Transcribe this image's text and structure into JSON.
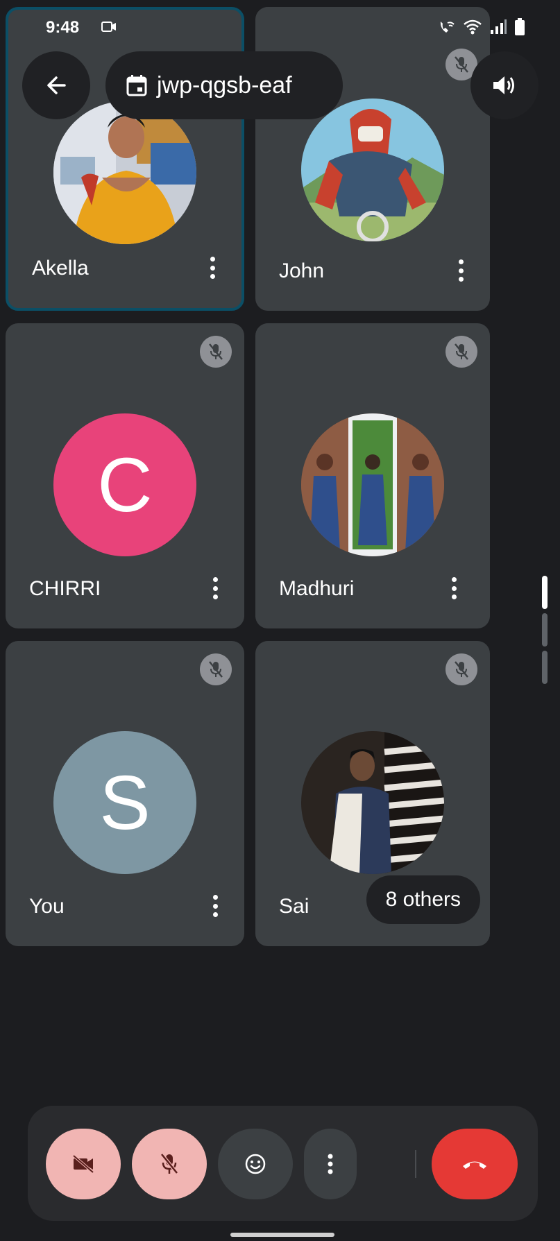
{
  "status_bar": {
    "time": "9:48",
    "icons": [
      "cast-icon",
      "wifi-call-icon",
      "wifi-icon",
      "signal-icon",
      "battery-icon"
    ]
  },
  "top_controls": {
    "back_icon": "arrow-left-icon",
    "meeting_code": "jwp-qgsb-eaf",
    "meeting_icon": "calendar-icon",
    "audio_icon": "speaker-icon"
  },
  "participants": [
    {
      "name": "Akella",
      "avatar_type": "photo",
      "active": true,
      "muted": false
    },
    {
      "name": "John",
      "avatar_type": "photo",
      "active": false,
      "muted": true
    },
    {
      "name": "CHIRRI",
      "avatar_type": "letter",
      "letter": "C",
      "avatar_color": "#e8437a",
      "muted": true
    },
    {
      "name": "Madhuri",
      "avatar_type": "photo",
      "muted": true
    },
    {
      "name": "You",
      "avatar_type": "letter",
      "letter": "S",
      "avatar_color": "#7e97a3",
      "muted": true
    },
    {
      "name": "Sai",
      "avatar_type": "photo",
      "muted": true
    }
  ],
  "others_pill": "8 others",
  "controls": {
    "camera": {
      "icon": "video-off-icon",
      "state": "off",
      "color": "#f1b5b3"
    },
    "mic": {
      "icon": "mic-off-icon",
      "state": "off",
      "color": "#f1b5b3"
    },
    "reactions": {
      "icon": "emoji-icon"
    },
    "more": {
      "icon": "more-vert-icon"
    },
    "end_call": {
      "icon": "end-call-icon",
      "color": "#e53935"
    }
  },
  "colors": {
    "background": "#1c1d20",
    "tile": "#3c4043",
    "active_border": "#0b4f66",
    "pill": "#202124"
  }
}
